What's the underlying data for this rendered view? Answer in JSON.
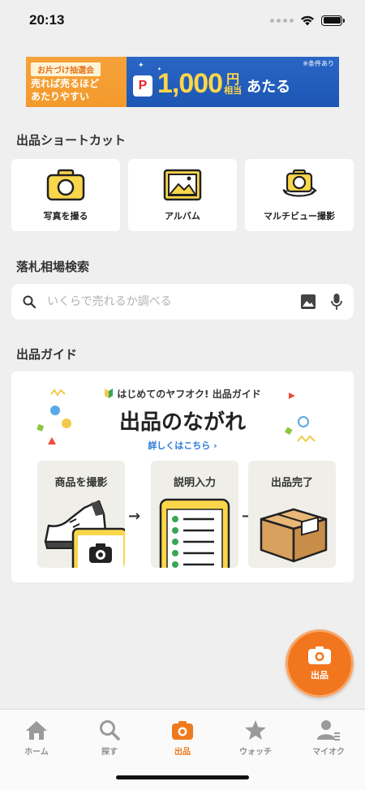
{
  "status_bar": {
    "time": "20:13"
  },
  "banner": {
    "tag": "お片づけ抽選会",
    "line1": "売れば売るほど",
    "line2": "あたりやすい",
    "paypay_mark": "P",
    "amount": "1,000",
    "unit": "円",
    "unit_sub": "相当",
    "cta": "あたる",
    "note": "※条件あり"
  },
  "shortcuts": {
    "title": "出品ショートカット",
    "items": [
      {
        "label": "写真を撮る",
        "icon": "camera-icon"
      },
      {
        "label": "アルバム",
        "icon": "album-icon"
      },
      {
        "label": "マルチビュー撮影",
        "icon": "multiview-camera-icon"
      }
    ]
  },
  "search": {
    "title": "落札相場検索",
    "placeholder": "いくらで売れるか調べる",
    "value": ""
  },
  "guide": {
    "title": "出品ガイド",
    "card_subtitle": "はじめてのヤフオク! 出品ガイド",
    "card_title": "出品のながれ",
    "link": "詳しくはこちら ›",
    "steps": [
      {
        "label": "商品を撮影"
      },
      {
        "label": "説明入力"
      },
      {
        "label": "出品完了"
      }
    ]
  },
  "fab": {
    "label": "出品"
  },
  "tabs": [
    {
      "label": "ホーム",
      "icon": "home-icon",
      "active": false
    },
    {
      "label": "探す",
      "icon": "search-icon",
      "active": false
    },
    {
      "label": "出品",
      "icon": "camera-icon",
      "active": true
    },
    {
      "label": "ウォッチ",
      "icon": "star-icon",
      "active": false
    },
    {
      "label": "マイオク",
      "icon": "user-icon",
      "active": false
    }
  ],
  "colors": {
    "accent": "#f2761e",
    "brand_blue": "#1d56b3",
    "banner_orange": "#f39a2c",
    "background": "#efefef",
    "icon_yellow": "#f9d64a",
    "link": "#2a7ad8"
  }
}
